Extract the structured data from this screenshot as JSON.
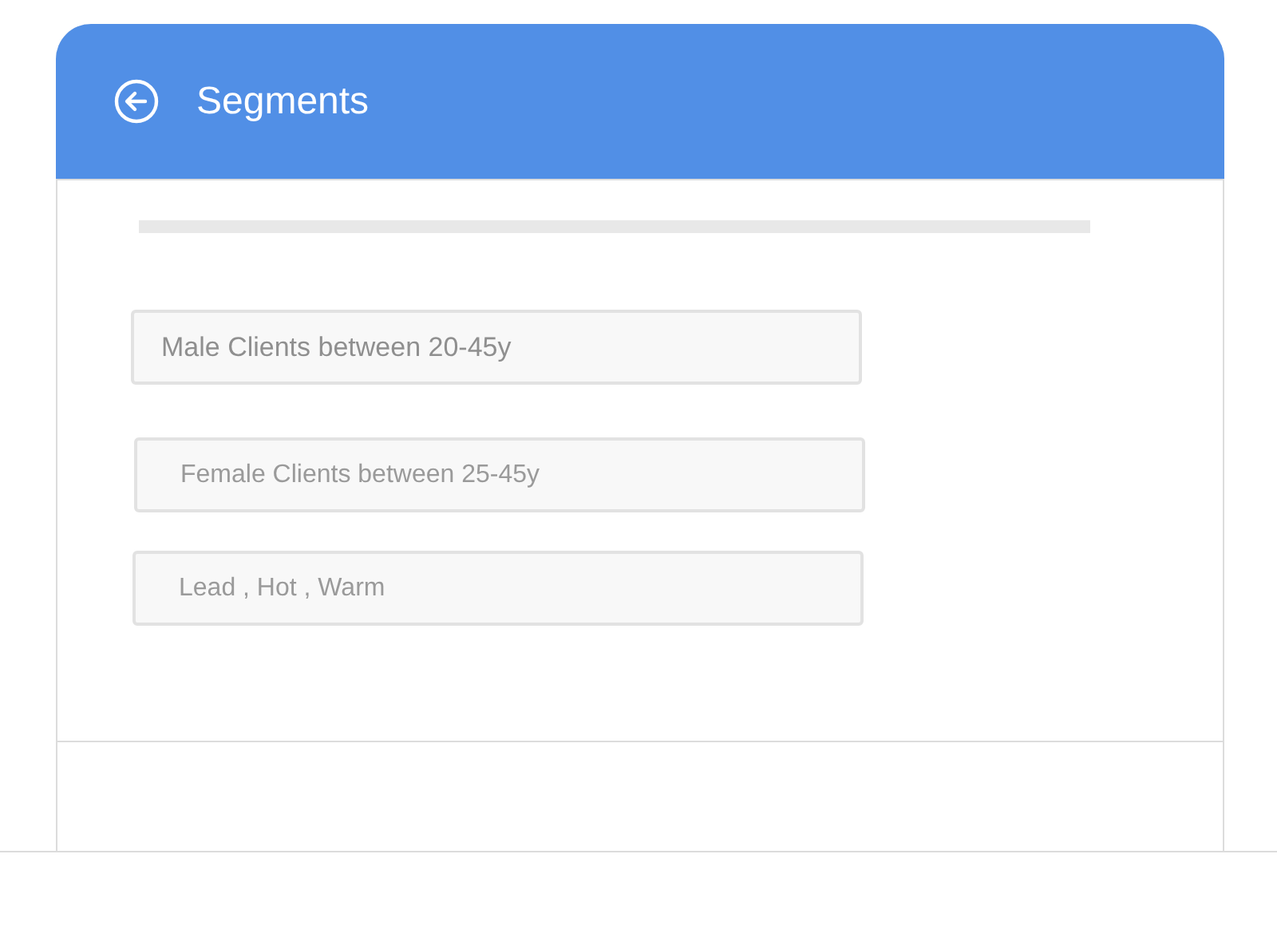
{
  "header": {
    "title": "Segments"
  },
  "segments": [
    {
      "label": "Male Clients between 20-45y"
    },
    {
      "label": "Female Clients between 25-45y"
    },
    {
      "label": "Lead , Hot , Warm"
    }
  ]
}
